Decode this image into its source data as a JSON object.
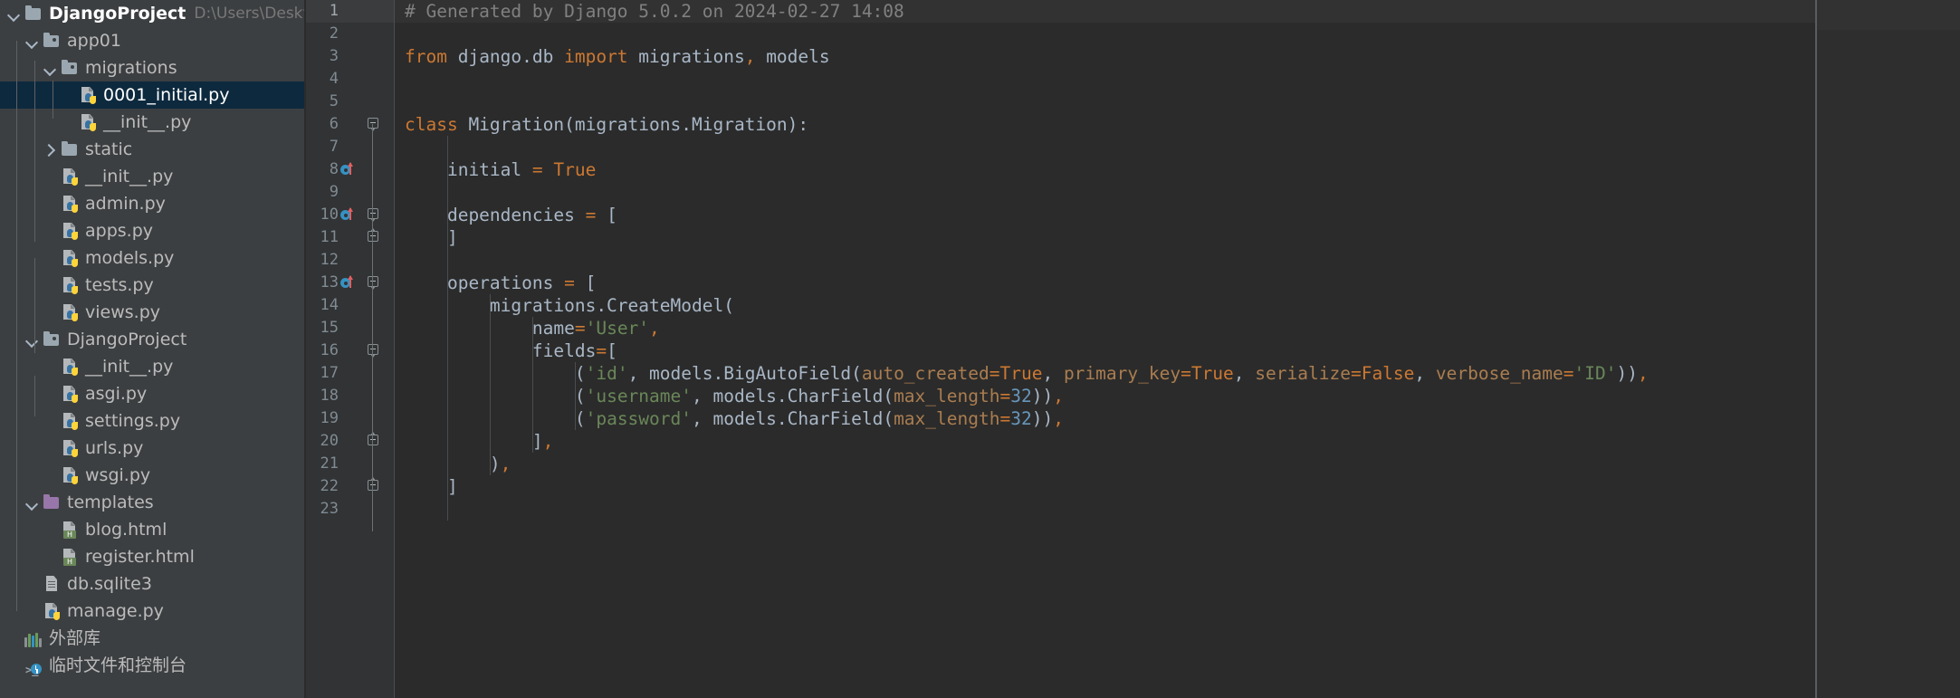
{
  "app": "PyCharm",
  "sidebar": {
    "project_name": "DjangoProject",
    "project_path": "D:\\Users\\Desktop\\",
    "items": [
      {
        "label": "DjangoProject",
        "sub": "D:\\Users\\Desktop\\",
        "icon": "folder-icon",
        "arrow": "down",
        "depth": 0,
        "bold": true,
        "selected": false
      },
      {
        "label": "app01",
        "sub": "",
        "icon": "source-folder-icon",
        "arrow": "down",
        "depth": 1,
        "bold": false,
        "selected": false
      },
      {
        "label": "migrations",
        "sub": "",
        "icon": "source-folder-icon",
        "arrow": "down",
        "depth": 2,
        "bold": false,
        "selected": false
      },
      {
        "label": "0001_initial.py",
        "sub": "",
        "icon": "python-file-icon",
        "arrow": "none",
        "depth": 3,
        "bold": false,
        "selected": true
      },
      {
        "label": "__init__.py",
        "sub": "",
        "icon": "python-file-icon",
        "arrow": "none",
        "depth": 3,
        "bold": false,
        "selected": false
      },
      {
        "label": "static",
        "sub": "",
        "icon": "folder-icon",
        "arrow": "right",
        "depth": 2,
        "bold": false,
        "selected": false
      },
      {
        "label": "__init__.py",
        "sub": "",
        "icon": "python-file-icon",
        "arrow": "none",
        "depth": 2,
        "bold": false,
        "selected": false
      },
      {
        "label": "admin.py",
        "sub": "",
        "icon": "python-file-icon",
        "arrow": "none",
        "depth": 2,
        "bold": false,
        "selected": false
      },
      {
        "label": "apps.py",
        "sub": "",
        "icon": "python-file-icon",
        "arrow": "none",
        "depth": 2,
        "bold": false,
        "selected": false
      },
      {
        "label": "models.py",
        "sub": "",
        "icon": "python-file-icon",
        "arrow": "none",
        "depth": 2,
        "bold": false,
        "selected": false
      },
      {
        "label": "tests.py",
        "sub": "",
        "icon": "python-file-icon",
        "arrow": "none",
        "depth": 2,
        "bold": false,
        "selected": false
      },
      {
        "label": "views.py",
        "sub": "",
        "icon": "python-file-icon",
        "arrow": "none",
        "depth": 2,
        "bold": false,
        "selected": false
      },
      {
        "label": "DjangoProject",
        "sub": "",
        "icon": "source-folder-icon",
        "arrow": "down",
        "depth": 1,
        "bold": false,
        "selected": false
      },
      {
        "label": "__init__.py",
        "sub": "",
        "icon": "python-file-icon",
        "arrow": "none",
        "depth": 2,
        "bold": false,
        "selected": false
      },
      {
        "label": "asgi.py",
        "sub": "",
        "icon": "python-file-icon",
        "arrow": "none",
        "depth": 2,
        "bold": false,
        "selected": false
      },
      {
        "label": "settings.py",
        "sub": "",
        "icon": "python-file-icon",
        "arrow": "none",
        "depth": 2,
        "bold": false,
        "selected": false
      },
      {
        "label": "urls.py",
        "sub": "",
        "icon": "python-file-icon",
        "arrow": "none",
        "depth": 2,
        "bold": false,
        "selected": false
      },
      {
        "label": "wsgi.py",
        "sub": "",
        "icon": "python-file-icon",
        "arrow": "none",
        "depth": 2,
        "bold": false,
        "selected": false
      },
      {
        "label": "templates",
        "sub": "",
        "icon": "template-folder-icon",
        "arrow": "down",
        "depth": 1,
        "bold": false,
        "selected": false
      },
      {
        "label": "blog.html",
        "sub": "",
        "icon": "html-file-icon",
        "arrow": "none",
        "depth": 2,
        "bold": false,
        "selected": false
      },
      {
        "label": "register.html",
        "sub": "",
        "icon": "html-file-icon",
        "arrow": "none",
        "depth": 2,
        "bold": false,
        "selected": false
      },
      {
        "label": "db.sqlite3",
        "sub": "",
        "icon": "database-file-icon",
        "arrow": "none",
        "depth": 1,
        "bold": false,
        "selected": false
      },
      {
        "label": "manage.py",
        "sub": "",
        "icon": "python-file-icon",
        "arrow": "none",
        "depth": 1,
        "bold": false,
        "selected": false
      },
      {
        "label": "外部库",
        "sub": "",
        "icon": "external-libraries-icon",
        "arrow": "none",
        "depth": 0,
        "bold": false,
        "selected": false
      },
      {
        "label": "临时文件和控制台",
        "sub": "",
        "icon": "scratches-consoles-icon",
        "arrow": "none",
        "depth": 0,
        "bold": false,
        "selected": false
      }
    ]
  },
  "editor": {
    "file": "0001_initial.py",
    "first_line_number": 1,
    "last_line_number": 23,
    "caret_line": 1,
    "gutter_markers": {
      "implementation_lines": [
        8,
        10,
        13
      ],
      "fold_open_lines": [
        6,
        10,
        13,
        16
      ],
      "fold_close_lines": [
        11,
        20,
        22
      ]
    },
    "lines": [
      {
        "n": 1,
        "text": "# Generated by Django 5.0.2 on 2024-02-27 14:08"
      },
      {
        "n": 2,
        "text": ""
      },
      {
        "n": 3,
        "text": "from django.db import migrations, models"
      },
      {
        "n": 4,
        "text": ""
      },
      {
        "n": 5,
        "text": ""
      },
      {
        "n": 6,
        "text": "class Migration(migrations.Migration):"
      },
      {
        "n": 7,
        "text": ""
      },
      {
        "n": 8,
        "text": "    initial = True"
      },
      {
        "n": 9,
        "text": ""
      },
      {
        "n": 10,
        "text": "    dependencies = ["
      },
      {
        "n": 11,
        "text": "    ]"
      },
      {
        "n": 12,
        "text": ""
      },
      {
        "n": 13,
        "text": "    operations = ["
      },
      {
        "n": 14,
        "text": "        migrations.CreateModel("
      },
      {
        "n": 15,
        "text": "            name='User',"
      },
      {
        "n": 16,
        "text": "            fields=["
      },
      {
        "n": 17,
        "text": "                ('id', models.BigAutoField(auto_created=True, primary_key=True, serialize=False, verbose_name='ID')),"
      },
      {
        "n": 18,
        "text": "                ('username', models.CharField(max_length=32)),"
      },
      {
        "n": 19,
        "text": "                ('password', models.CharField(max_length=32)),"
      },
      {
        "n": 20,
        "text": "            ],"
      },
      {
        "n": 21,
        "text": "        ),"
      },
      {
        "n": 22,
        "text": "    ]"
      },
      {
        "n": 23,
        "text": ""
      }
    ],
    "code_text": {
      "l1_comment": "# Generated by Django 5.0.2 on 2024-02-27 14:08",
      "l3_from": "from",
      "l3_module": " django.db ",
      "l3_import": "import",
      "l3_names": " migrations",
      "l3_comma": ",",
      "l3_names2": " models",
      "l6_class": "class",
      "l6_rest": " Migration(migrations.Migration):",
      "l8_initial": "    initial ",
      "l8_eq": "=",
      "l8_true": " True",
      "l10_dep": "    dependencies ",
      "l10_eq": "=",
      "l10_br": " [",
      "l11": "    ]",
      "l13_ops": "    operations ",
      "l13_eq": "=",
      "l13_br": " [",
      "l14": "        migrations.CreateModel(",
      "l15_name": "            name",
      "l15_eq": "=",
      "l15_str": "'User'",
      "l15_comma": ",",
      "l16_fields": "            fields",
      "l16_eq": "=",
      "l16_br": "[",
      "l17_a": "                (",
      "l17_id": "'id'",
      "l17_b": ", models.BigAutoField(",
      "l17_kw1": "auto_created",
      "l17_eq1": "=",
      "l17_v1": "True",
      "l17_c1": ", ",
      "l17_kw2": "primary_key",
      "l17_eq2": "=",
      "l17_v2": "True",
      "l17_c2": ", ",
      "l17_kw3": "serialize",
      "l17_eq3": "=",
      "l17_v3": "False",
      "l17_c3": ", ",
      "l17_kw4": "verbose_name",
      "l17_eq4": "=",
      "l17_v4": "'ID'",
      "l17_end": "))",
      "l17_comma": ",",
      "l18_a": "                (",
      "l18_str": "'username'",
      "l18_b": ", models.CharField(",
      "l18_kw": "max_length",
      "l18_eq": "=",
      "l18_num": "32",
      "l18_end": "))",
      "l18_comma": ",",
      "l19_a": "                (",
      "l19_str": "'password'",
      "l19_b": ", models.CharField(",
      "l19_kw": "max_length",
      "l19_eq": "=",
      "l19_num": "32",
      "l19_end": "))",
      "l19_comma": ",",
      "l20_br": "            ]",
      "l20_comma": ",",
      "l21_br": "        )",
      "l21_comma": ",",
      "l22": "    ]"
    }
  },
  "colors": {
    "editor_bg": "#2b2b2b",
    "gutter_bg": "#313335",
    "sidebar_bg": "#3c3f41",
    "selection_bg": "#0d293e",
    "caret_line_bg": "#323232",
    "text": "#a9b7c6",
    "comment": "#808080",
    "keyword": "#cc7832",
    "string": "#6a8759",
    "kwarg": "#aa7d50",
    "number": "#6897bb",
    "marker_cyan": "#3592c4",
    "marker_red": "#e05f5f"
  }
}
